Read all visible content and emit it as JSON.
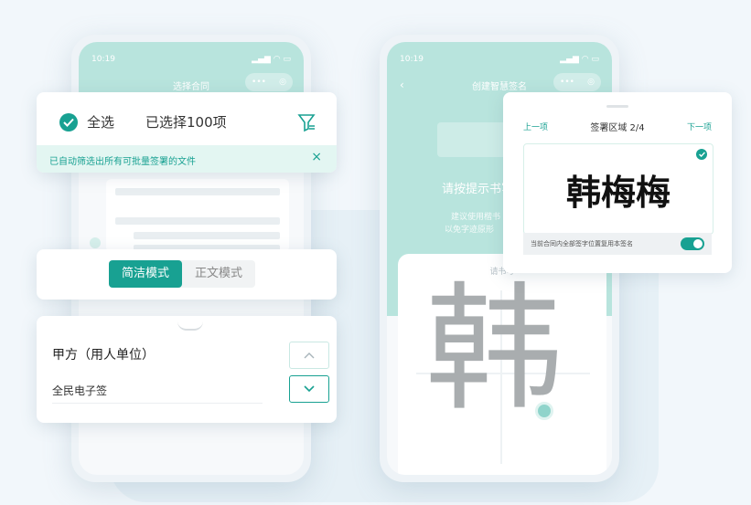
{
  "left_phone": {
    "status_time": "10:19",
    "nav_title": "选择合同",
    "select_all_label": "全选",
    "selected_count": "已选择100项",
    "auto_filter_notice": "已自动筛选出所有可批量签署的文件",
    "mode_simple": "简洁模式",
    "mode_text": "正文模式",
    "party_label": "甲方（用人单位）",
    "sign_type": "全民电子签"
  },
  "right_phone": {
    "status_time": "10:19",
    "nav_title": "创建智慧签名",
    "prompt": "请按提示书写",
    "hint_line1": "建议使用楷书",
    "hint_line2": "以免字迹原形",
    "write_hint": "请书写",
    "big_char": "韩"
  },
  "sign_card": {
    "prev": "上一项",
    "area": "签署区域 2/4",
    "next": "下一项",
    "signature_text": "韩梅梅",
    "reuse_label": "当前合同内全部签字位置复用本签名",
    "reuse_on": true
  },
  "colors": {
    "accent": "#18a192",
    "light_teal": "#b8e4dd"
  }
}
